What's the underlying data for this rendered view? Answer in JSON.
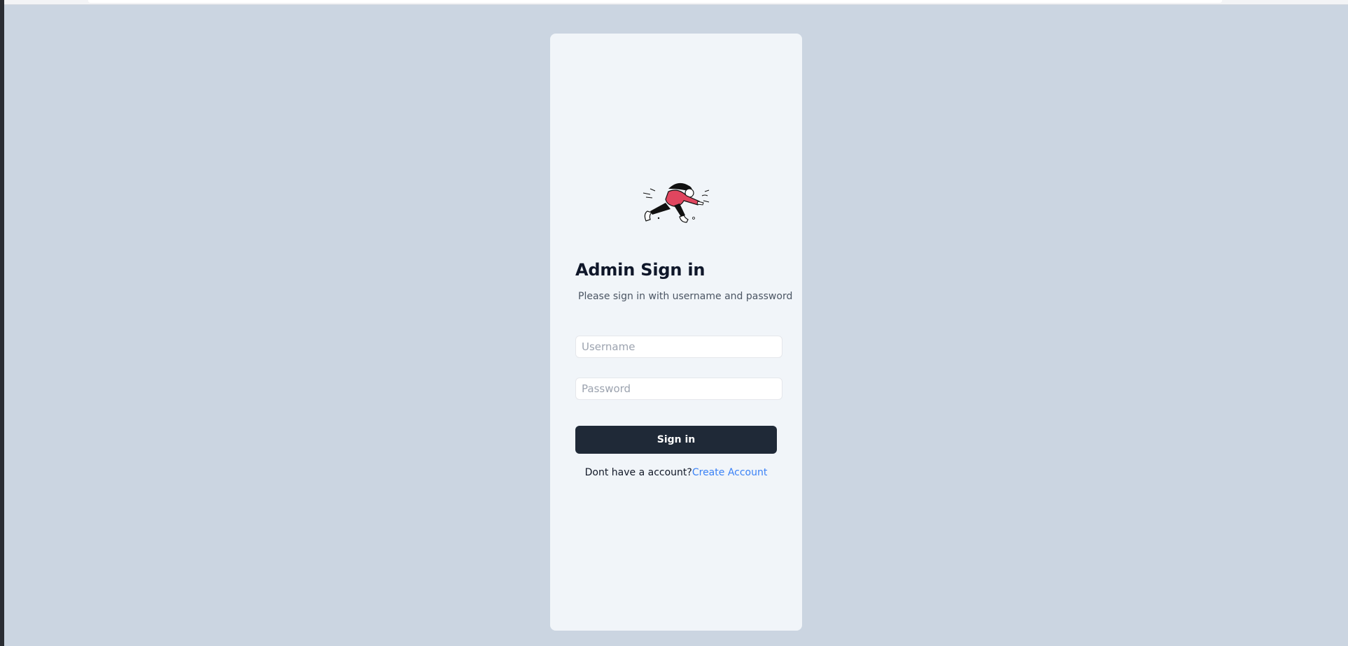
{
  "login": {
    "title": "Admin Sign in",
    "subtitle": "Please sign in with username and password",
    "username_placeholder": "Username",
    "password_placeholder": "Password",
    "username_value": "",
    "password_value": "",
    "submit_label": "Sign in",
    "no_account_text": "Dont have a account?",
    "create_account_label": "Create Account",
    "illustration": "running-person-illustration"
  },
  "colors": {
    "background": "#cbd5e1",
    "card": "#f1f5f9",
    "button": "#1f2937",
    "link": "#3b82f6",
    "accent_red": "#e0465f"
  }
}
